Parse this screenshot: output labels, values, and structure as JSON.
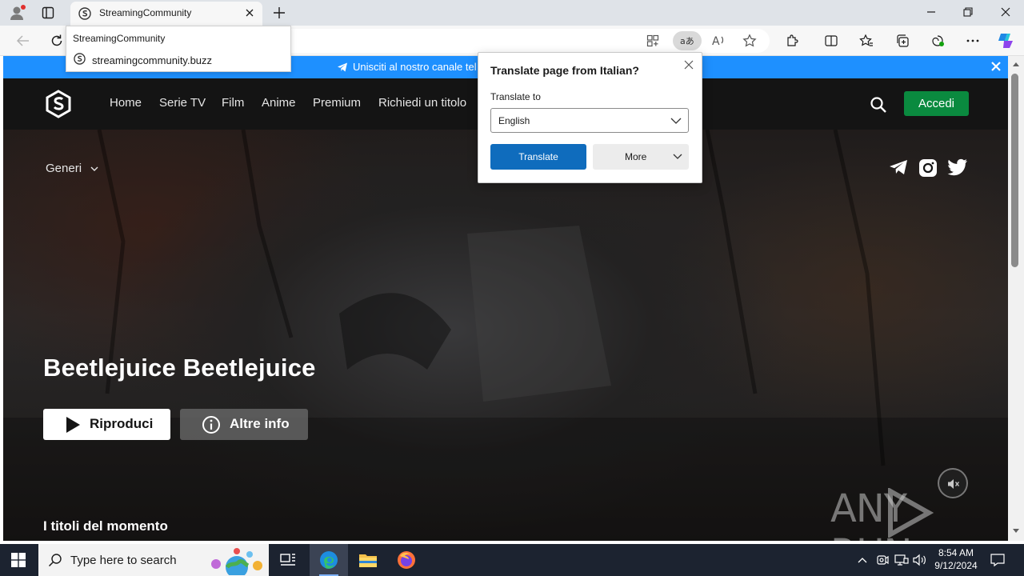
{
  "browser": {
    "tab_title": "StreamingCommunity",
    "omnibox_suggestion_title": "StreamingCommunity",
    "omnibox_suggestion_url": "streamingcommunity.buzz"
  },
  "banner": {
    "text": "Unisciti al nostro canale tel"
  },
  "nav": {
    "links": [
      "Home",
      "Serie TV",
      "Film",
      "Anime",
      "Premium",
      "Richiedi un titolo"
    ],
    "login_label": "Accedi",
    "genres_label": "Generi"
  },
  "hero": {
    "title": "Beetlejuice Beetlejuice",
    "play_label": "Riproduci",
    "info_label": "Altre info",
    "section_title": "I titoli del momento"
  },
  "translate_popup": {
    "heading": "Translate page from Italian?",
    "translate_to_label": "Translate to",
    "selected_language": "English",
    "translate_button": "Translate",
    "more_button": "More"
  },
  "watermark": {
    "left": "ANY",
    "right": "RUN"
  },
  "taskbar": {
    "search_placeholder": "Type here to search",
    "time": "8:54 AM",
    "date": "9/12/2024"
  },
  "colors": {
    "banner_blue": "#1e90ff",
    "login_green": "#0a8a3f",
    "translate_blue": "#0f6cbd",
    "page_dark": "#141414"
  }
}
